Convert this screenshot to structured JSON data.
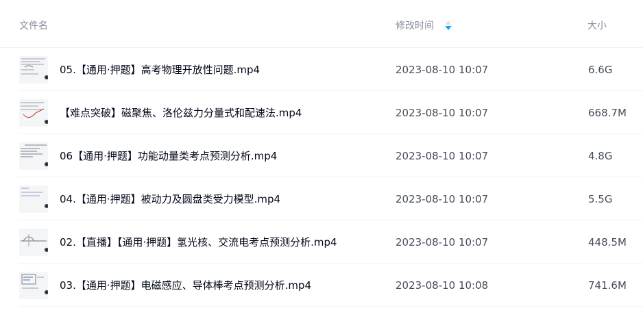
{
  "header": {
    "name_label": "文件名",
    "time_label": "修改时间",
    "size_label": "大小",
    "sort_icon": "sort-descending-icon"
  },
  "files": [
    {
      "name": "05.【通用·押题】高考物理开放性问题.mp4",
      "modified": "2023-08-10 10:07",
      "size": "6.6G",
      "thumb": "video-thumbnail-icon"
    },
    {
      "name": "【难点突破】磁聚焦、洛伦兹力分量式和配速法.mp4",
      "modified": "2023-08-10 10:07",
      "size": "668.7M",
      "thumb": "video-thumbnail-icon"
    },
    {
      "name": "06【通用·押题】功能动量类考点预测分析.mp4",
      "modified": "2023-08-10 10:07",
      "size": "4.8G",
      "thumb": "video-thumbnail-icon"
    },
    {
      "name": "04.【通用·押题】被动力及圆盘类受力模型.mp4",
      "modified": "2023-08-10 10:07",
      "size": "5.5G",
      "thumb": "video-thumbnail-icon"
    },
    {
      "name": "02.【直播】【通用·押题】氢光核、交流电考点预测分析.mp4",
      "modified": "2023-08-10 10:07",
      "size": "448.5M",
      "thumb": "video-thumbnail-icon"
    },
    {
      "name": "03.【通用·押题】电磁感应、导体棒考点预测分析.mp4",
      "modified": "2023-08-10 10:08",
      "size": "741.6M",
      "thumb": "video-thumbnail-icon"
    }
  ],
  "colors": {
    "header_text": "#878c9c",
    "name_text": "#03081a",
    "meta_text": "#454d5a",
    "divider": "#f1f2f4",
    "sort_active": "#06a7ff"
  }
}
